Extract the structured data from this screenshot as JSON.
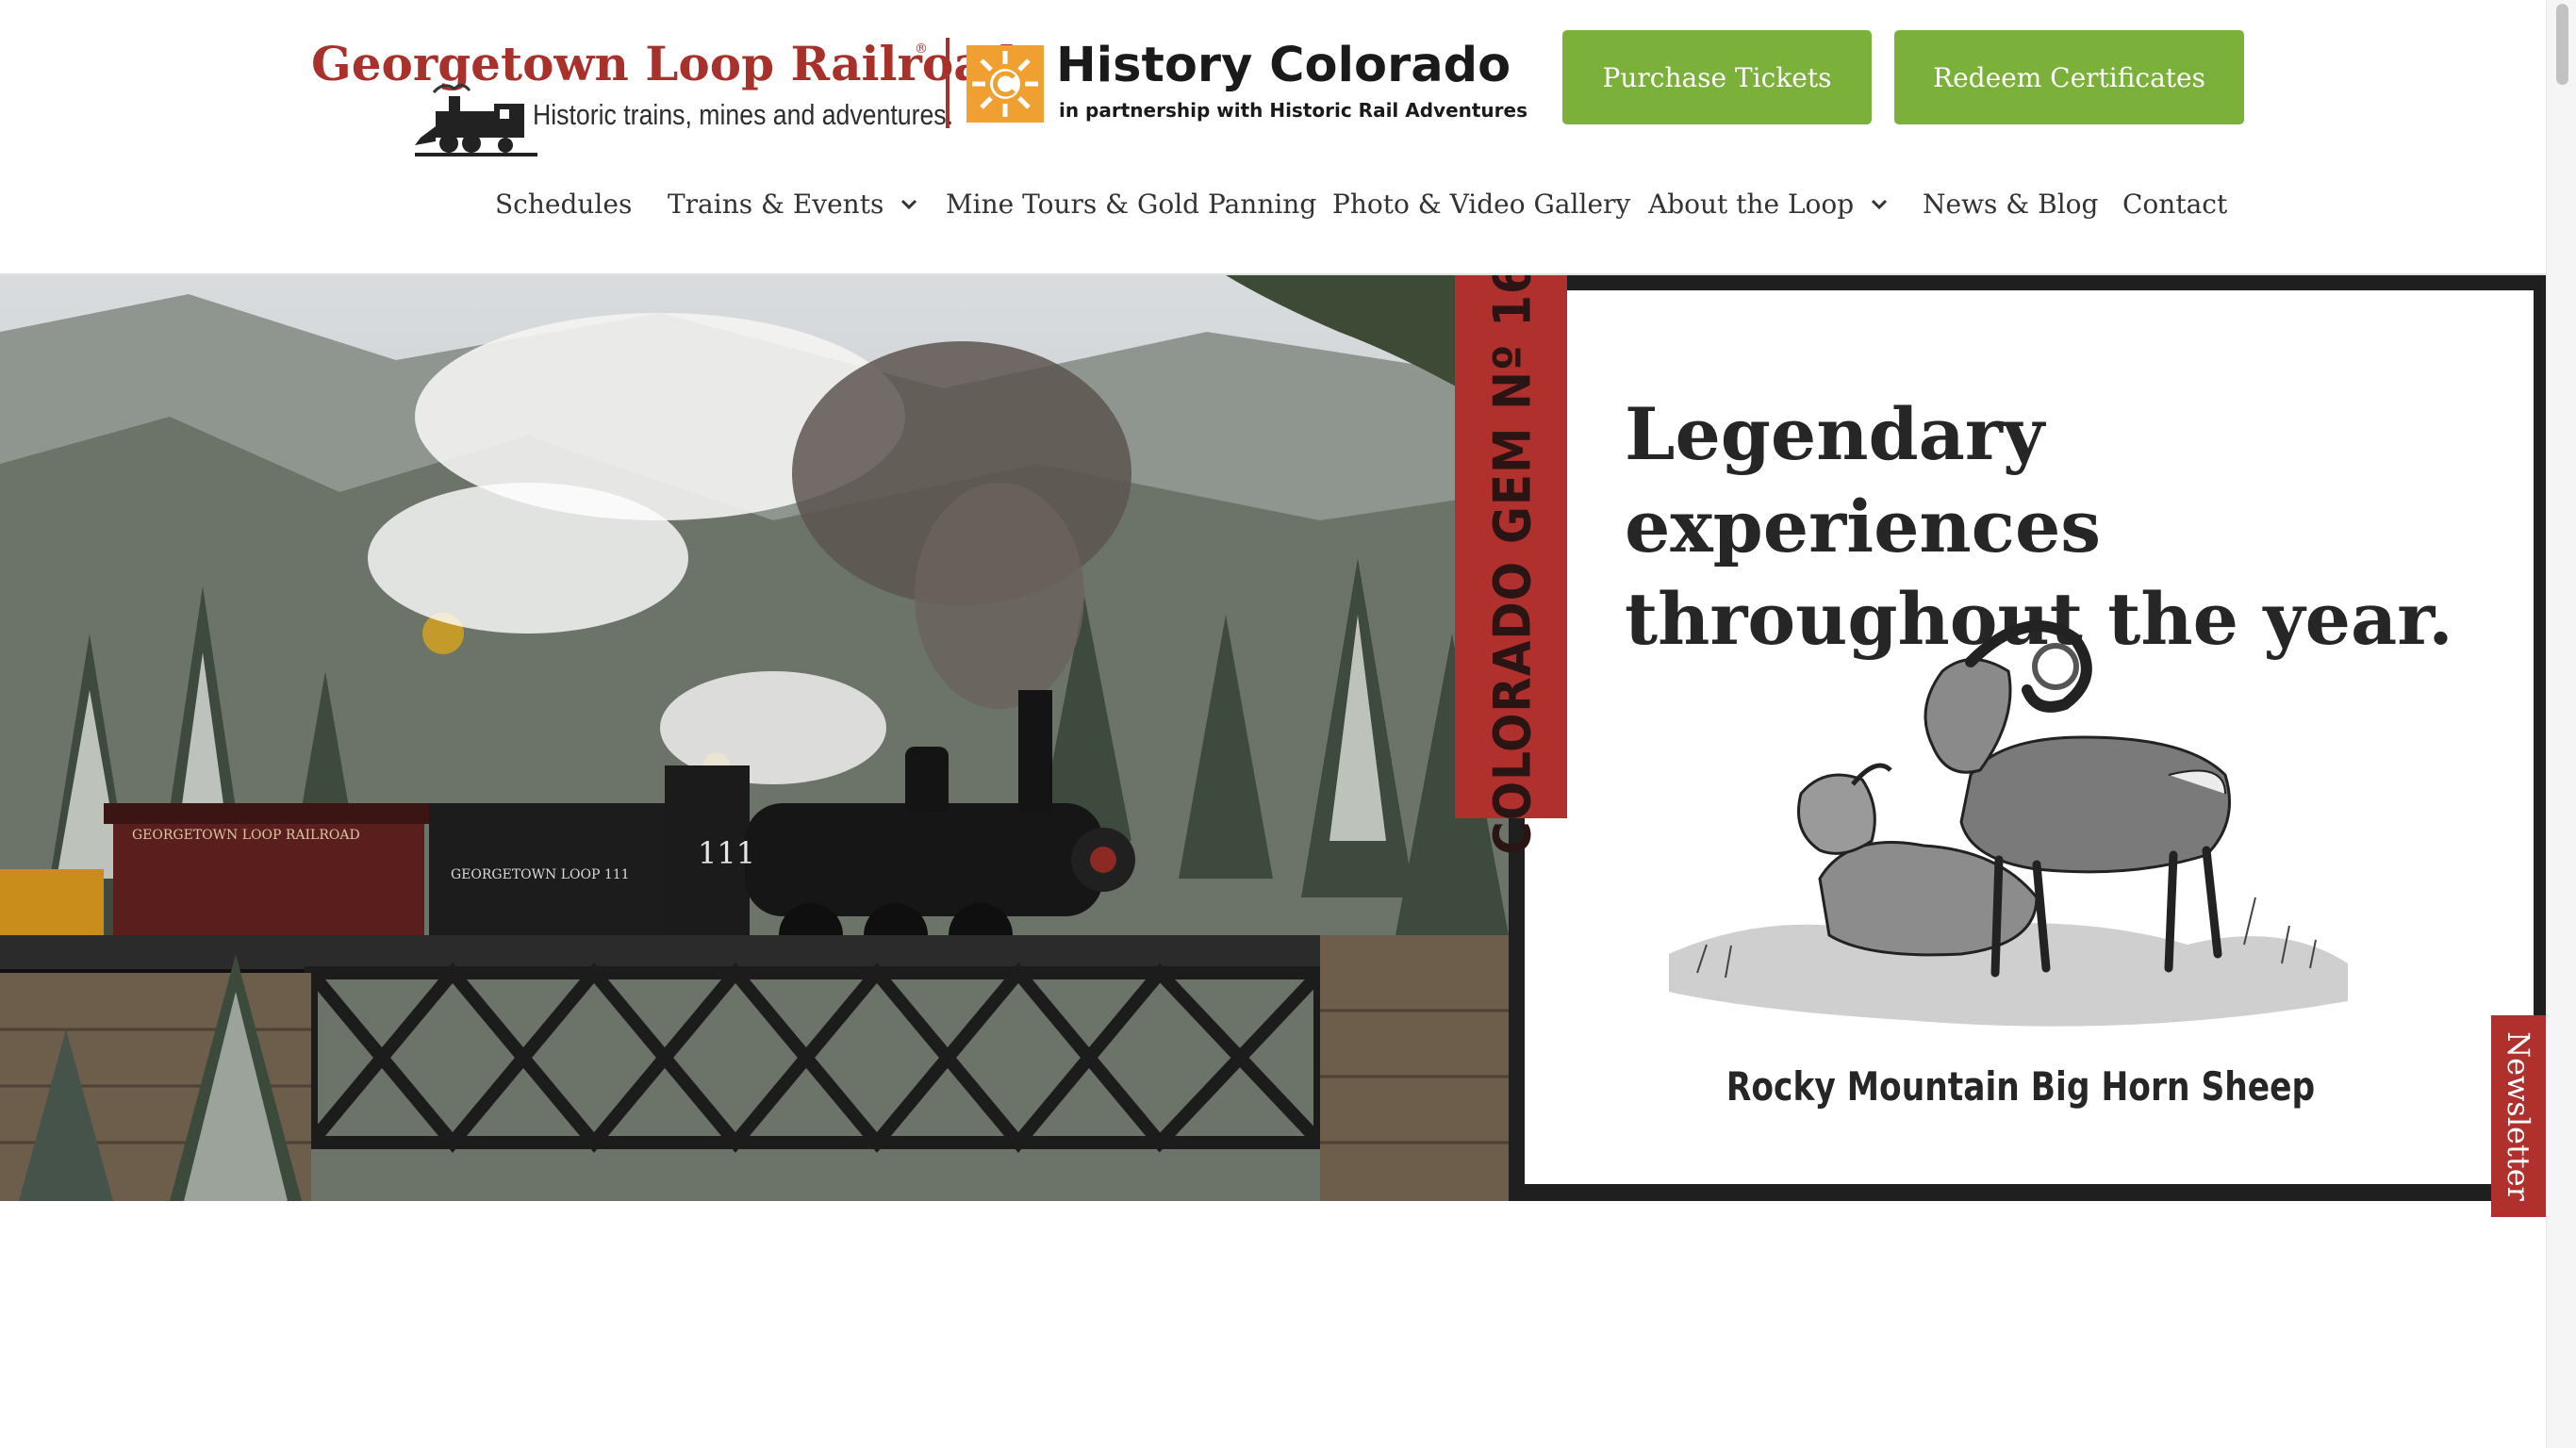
{
  "brand": {
    "title": "Georgetown Loop Railroad",
    "registered": "®",
    "tagline": "Historic trains, mines and adventures.",
    "partner_title": "History Colorado",
    "partner_subtitle": "in partnership with Historic Rail Adventures"
  },
  "header_buttons": {
    "purchase": "Purchase Tickets",
    "redeem": "Redeem Certificates"
  },
  "nav": {
    "items": [
      {
        "label": "Schedules",
        "dropdown": false
      },
      {
        "label": "Trains & Events",
        "dropdown": true
      },
      {
        "label": "Mine Tours & Gold Panning",
        "dropdown": false
      },
      {
        "label": "Photo & Video Gallery",
        "dropdown": false
      },
      {
        "label": "About the Loop",
        "dropdown": true
      },
      {
        "label": "News & Blog",
        "dropdown": false
      },
      {
        "label": "Contact",
        "dropdown": false
      }
    ]
  },
  "hero": {
    "gem_label": "COLORADO GEM Nº 16",
    "headline": "Legendary experiences throughout the year.",
    "caption": "Rocky Mountain Big Horn Sheep",
    "locomotive_number": "111",
    "tender_text": "GEORGETOWN LOOP 111",
    "coach_text": "GEORGETOWN LOOP RAILROAD"
  },
  "newsletter": {
    "label": "Newsletter"
  },
  "colors": {
    "brand_red": "#a8322b",
    "button_green": "#7bb03b",
    "gem_red": "#b0302d",
    "hc_orange": "#f0a031"
  }
}
